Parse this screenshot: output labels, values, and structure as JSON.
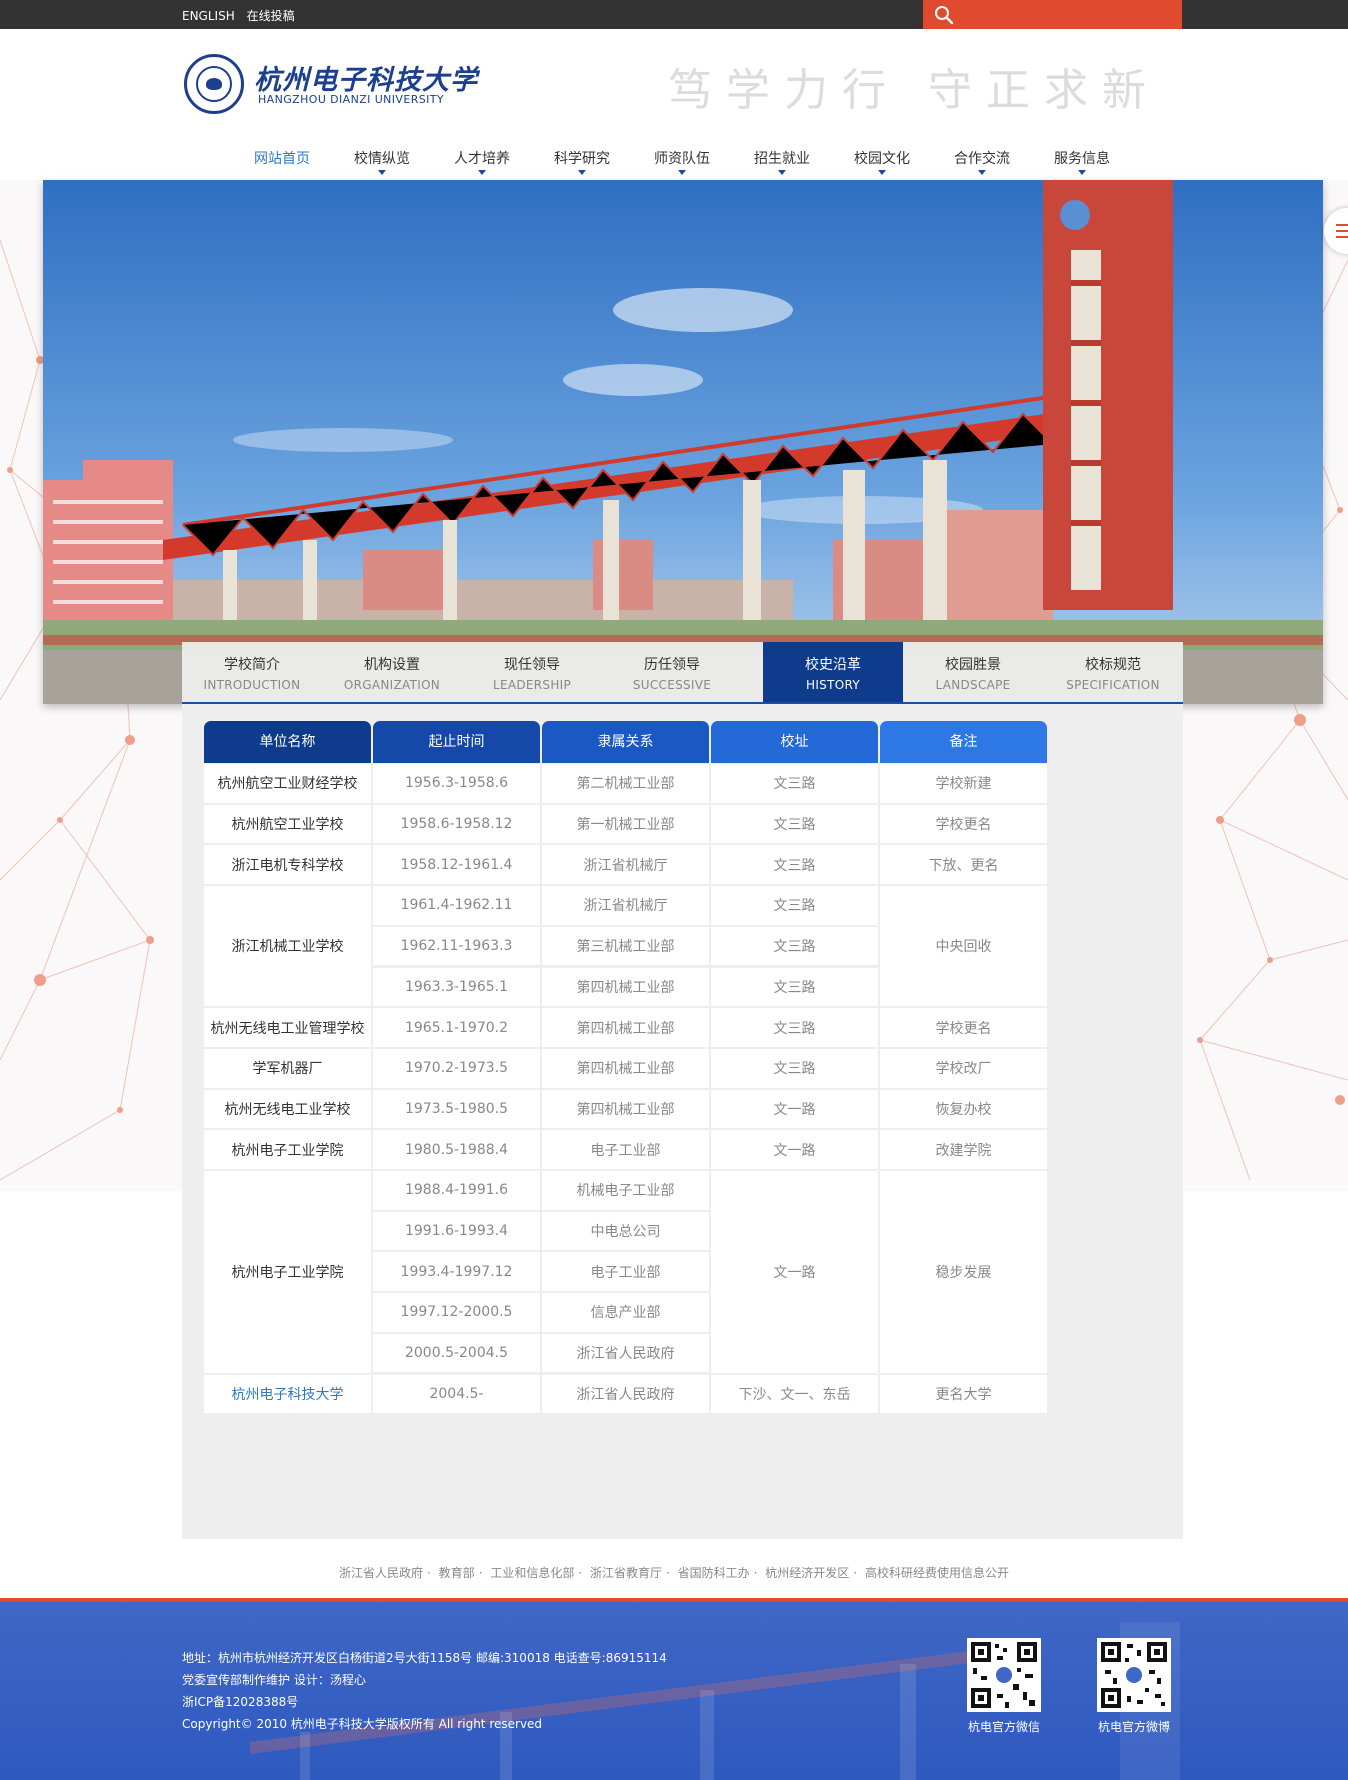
{
  "topbar": {
    "english": "ENGLISH",
    "submit": "在线投稿"
  },
  "logo": {
    "cn": "杭州电子科技大学",
    "en": "HANGZHOU DIANZI UNIVERSITY"
  },
  "motto": "笃学力行 守正求新",
  "nav": [
    "网站首页",
    "校情纵览",
    "人才培养",
    "科学研究",
    "师资队伍",
    "招生就业",
    "校园文化",
    "合作交流",
    "服务信息"
  ],
  "tabs": [
    {
      "cn": "学校简介",
      "en": "INTRODUCTION"
    },
    {
      "cn": "机构设置",
      "en": "ORGANIZATION"
    },
    {
      "cn": "现任领导",
      "en": "LEADERSHIP"
    },
    {
      "cn": "历任领导",
      "en": "SUCCESSIVE"
    },
    {
      "cn": "校史沿革",
      "en": "HISTORY"
    },
    {
      "cn": "校园胜景",
      "en": "LANDSCAPE"
    },
    {
      "cn": "校标规范",
      "en": "SPECIFICATION"
    }
  ],
  "active_tab": "校史沿革",
  "table": {
    "headers": [
      "单位名称",
      "起止时间",
      "隶属关系",
      "校址",
      "备注"
    ],
    "header_colors": [
      "#0f3b8c",
      "#1548a8",
      "#1a58c4",
      "#2469d8",
      "#2e78e6"
    ],
    "rows": [
      {
        "name": "杭州航空工业财经学校",
        "period": "1956.3-1958.6",
        "affiliation": "第二机械工业部",
        "site": "文三路",
        "remark": "学校新建"
      },
      {
        "name": "杭州航空工业学校",
        "period": "1958.6-1958.12",
        "affiliation": "第一机械工业部",
        "site": "文三路",
        "remark": "学校更名"
      },
      {
        "name": "浙江电机专科学校",
        "period": "1958.12-1961.4",
        "affiliation": "浙江省机械厅",
        "site": "文三路",
        "remark": "下放、更名"
      },
      {
        "name": "浙江机械工业学校",
        "period": "1961.4-1962.11",
        "affiliation": "浙江省机械厅",
        "site": "文三路",
        "remark": "中央回收"
      },
      {
        "name": "",
        "period": "1962.11-1963.3",
        "affiliation": "第三机械工业部",
        "site": "文三路",
        "remark": ""
      },
      {
        "name": "",
        "period": "1963.3-1965.1",
        "affiliation": "第四机械工业部",
        "site": "文三路",
        "remark": ""
      },
      {
        "name": "杭州无线电工业管理学校",
        "period": "1965.1-1970.2",
        "affiliation": "第四机械工业部",
        "site": "文三路",
        "remark": "学校更名"
      },
      {
        "name": "学军机器厂",
        "period": "1970.2-1973.5",
        "affiliation": "第四机械工业部",
        "site": "文三路",
        "remark": "学校改厂"
      },
      {
        "name": "杭州无线电工业学校",
        "period": "1973.5-1980.5",
        "affiliation": "第四机械工业部",
        "site": "文一路",
        "remark": "恢复办校"
      },
      {
        "name": "杭州电子工业学院",
        "period": "1980.5-1988.4",
        "affiliation": "电子工业部",
        "site": "文一路",
        "remark": "改建学院"
      },
      {
        "name": "杭州电子工业学院",
        "period": "1988.4-1991.6",
        "affiliation": "机械电子工业部",
        "site": "文一路",
        "remark": "稳步发展"
      },
      {
        "name": "",
        "period": "1991.6-1993.4",
        "affiliation": "中电总公司",
        "site": "",
        "remark": ""
      },
      {
        "name": "",
        "period": "1993.4-1997.12",
        "affiliation": "电子工业部",
        "site": "",
        "remark": ""
      },
      {
        "name": "",
        "period": "1997.12-2000.5",
        "affiliation": "信息产业部",
        "site": "",
        "remark": ""
      },
      {
        "name": "",
        "period": "2000.5-2004.5",
        "affiliation": "浙江省人民政府",
        "site": "",
        "remark": ""
      },
      {
        "name": "杭州电子科技大学",
        "period": "2004.5-",
        "affiliation": "浙江省人民政府",
        "site": "下沙、文一、东岳",
        "remark": "更名大学"
      }
    ]
  },
  "footer_links": [
    "浙江省人民政府",
    "教育部",
    "工业和信息化部",
    "浙江省教育厅",
    "省国防科工办",
    "杭州经济开发区",
    "高校科研经费使用信息公开"
  ],
  "footer": {
    "address": "地址：杭州市杭州经济开发区白杨街道2号大街1158号 邮编:310018 电话查号:86915114",
    "maintainer": "党委宣传部制作维护 设计：汤程心",
    "icp": "浙ICP备12028388号",
    "copyright": "Copyright© 2010 杭州电子科技大学版权所有 All right reserved",
    "qr_wechat": "杭电官方微信",
    "qr_weibo": "杭电官方微博"
  },
  "colors": {
    "accent": "#e04a2f",
    "brand": "#1c3f8f",
    "active_tab": "#0f3b8c",
    "footer": "#3a63c4"
  },
  "icons": [
    "search-icon",
    "menu-icon"
  ]
}
